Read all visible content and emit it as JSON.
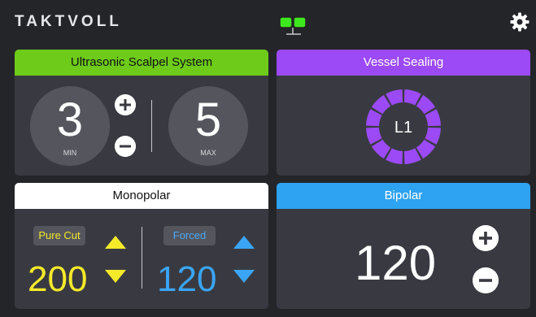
{
  "header": {
    "brand": "TAKTVOLL",
    "link_icon": "connection-status-icon",
    "link_color": "#3ee81e",
    "settings_icon": "gear-icon"
  },
  "ultrasonic": {
    "title": "Ultrasonic Scalpel System",
    "accent": "#6ecb1a",
    "min_value": "3",
    "min_label": "MIN",
    "max_value": "5",
    "max_label": "MAX",
    "increase_icon": "plus-icon",
    "decrease_icon": "minus-icon"
  },
  "vessel": {
    "title": "Vessel Sealing",
    "accent": "#9b4af5",
    "level": "L1",
    "ring_segments": 12
  },
  "monopolar": {
    "title": "Monopolar",
    "cut_mode": "Pure Cut",
    "cut_value": "200",
    "cut_color": "#f4ea2a",
    "coag_mode": "Forced",
    "coag_value": "120",
    "coag_color": "#3aa5f4"
  },
  "bipolar": {
    "title": "Bipolar",
    "accent": "#2ea3f2",
    "value": "120"
  }
}
